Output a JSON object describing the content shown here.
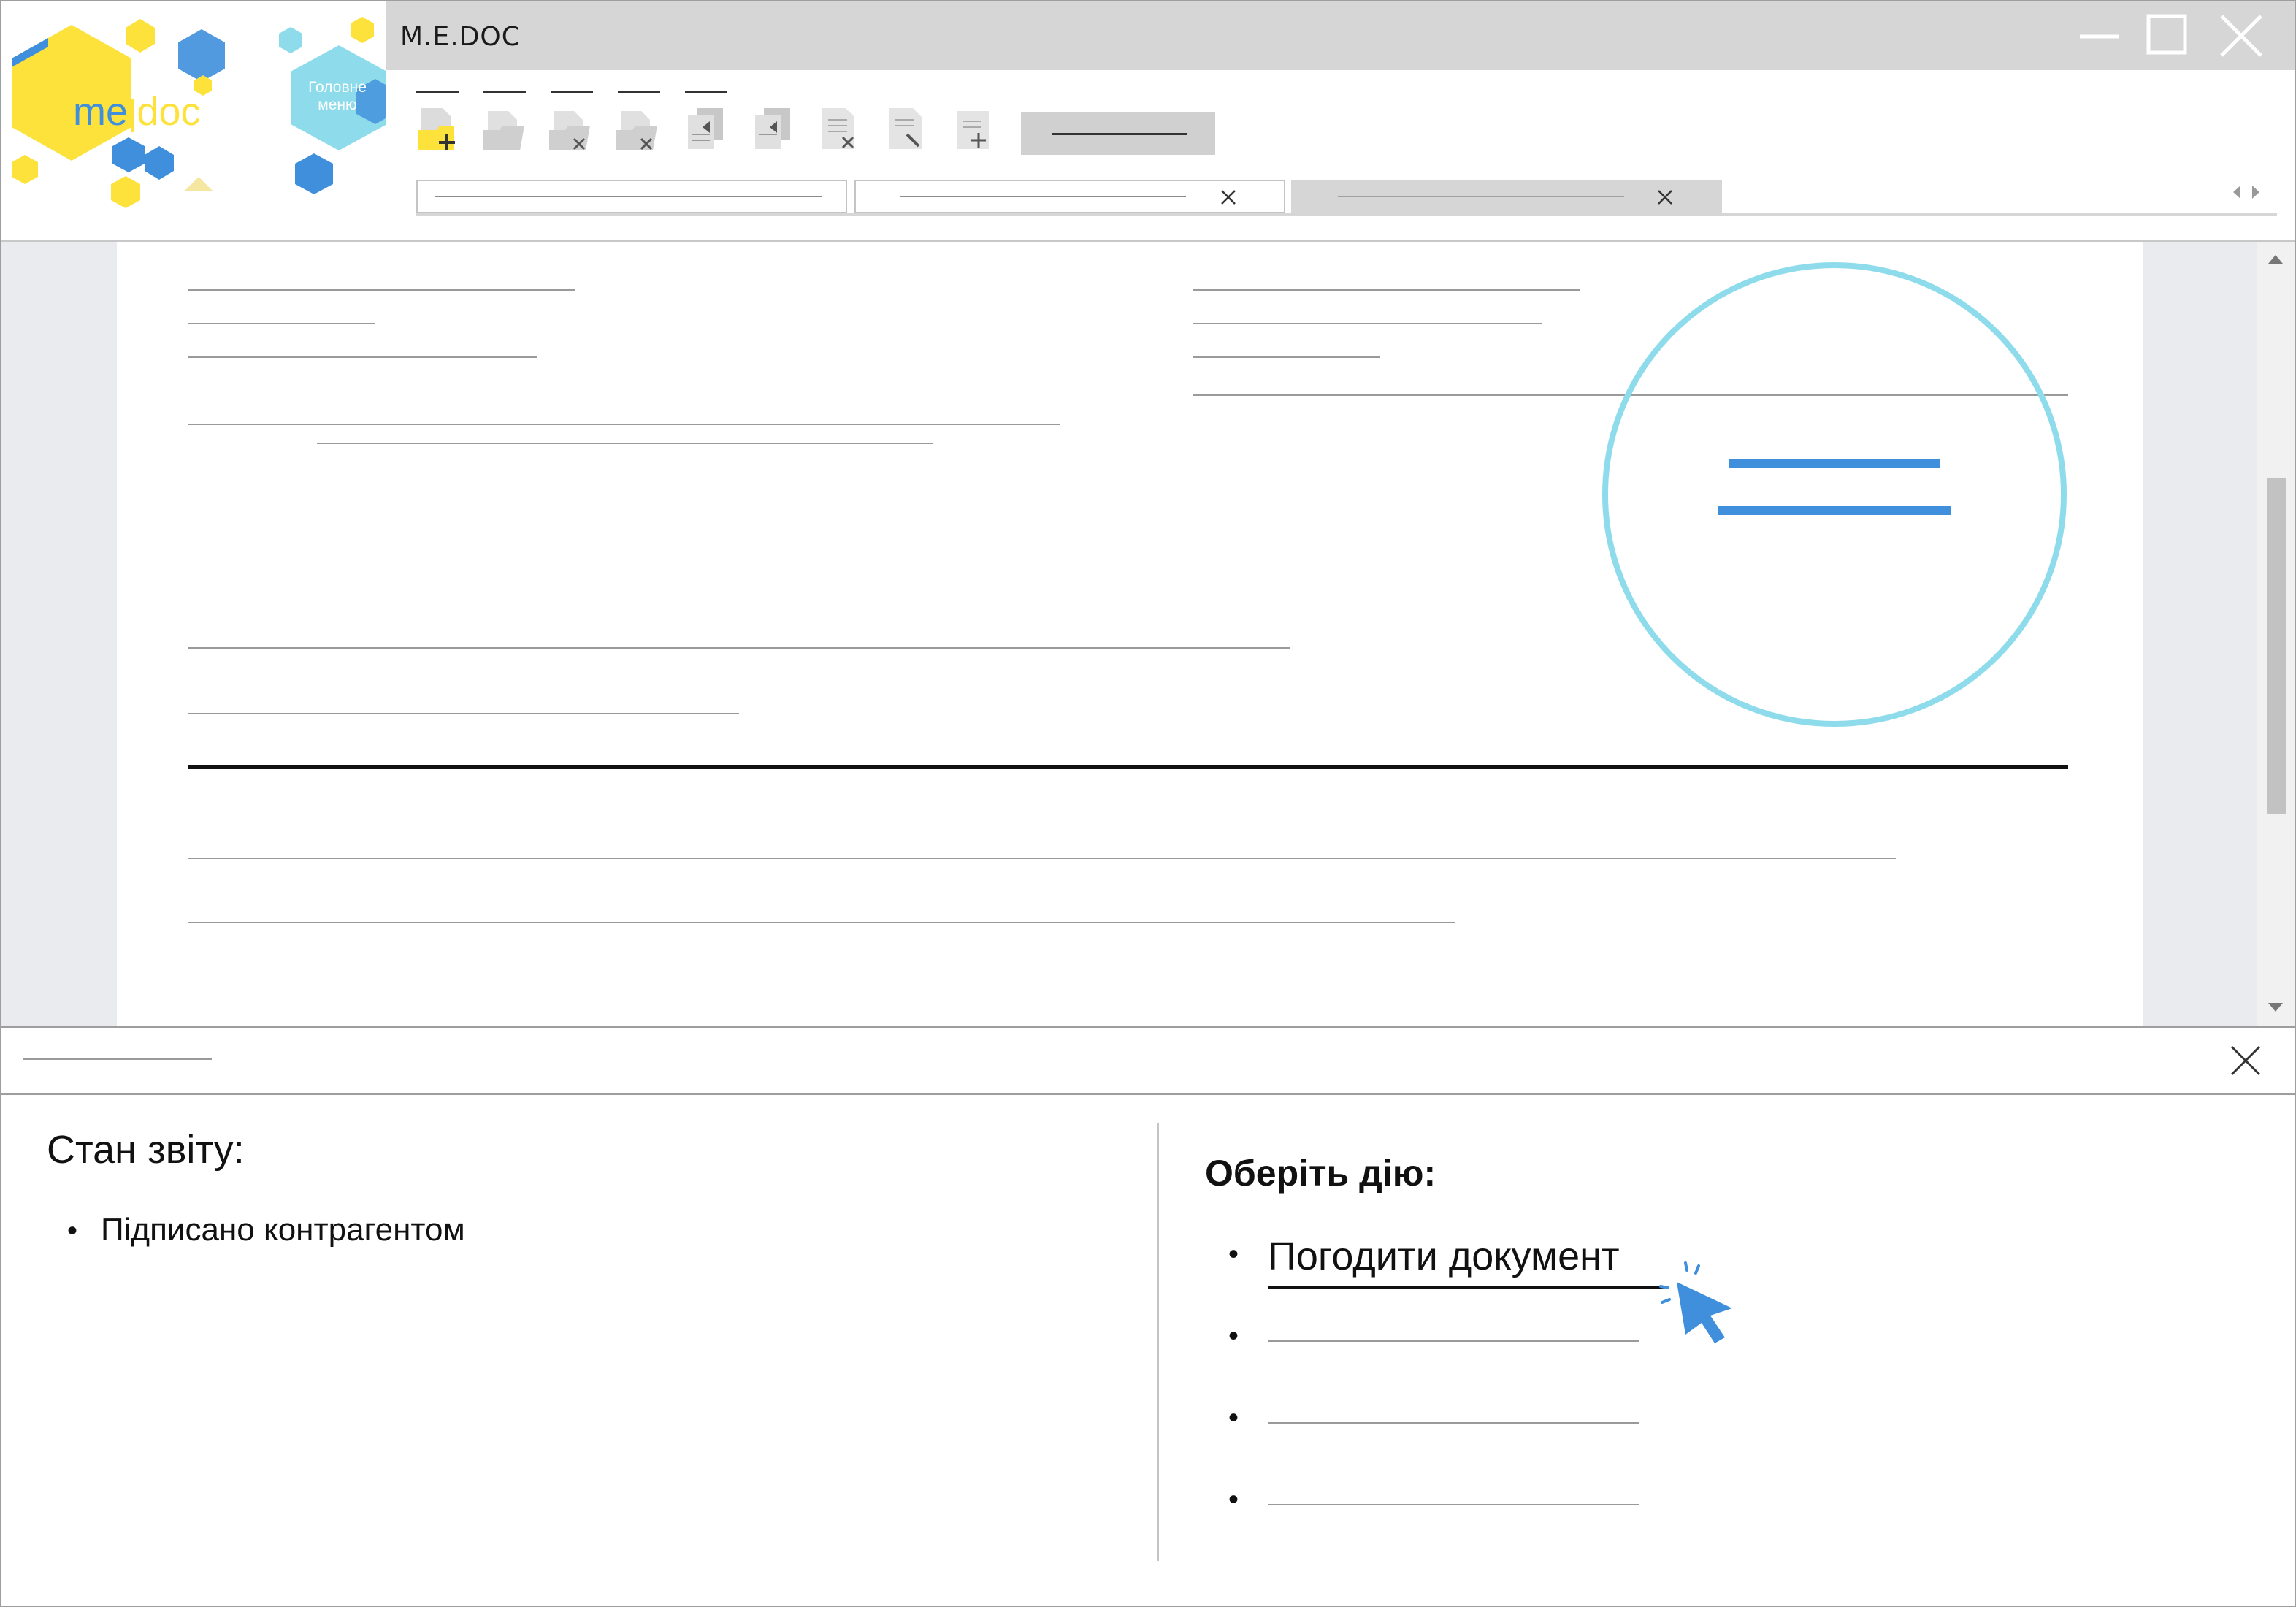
{
  "app": {
    "title": "M.E.DOC",
    "logo_text_me": "me",
    "logo_text_doc": "doc",
    "main_menu_label": "Головне меню"
  },
  "window_controls": {
    "minimize_icon": "minimize-icon",
    "maximize_icon": "maximize-icon",
    "close_icon": "close-icon"
  },
  "toolbar": {
    "icons": [
      "new-document-icon",
      "open-folder-icon",
      "delete-document-icon",
      "delete-folder-icon",
      "copy-document-icon",
      "move-document-icon",
      "reject-document-icon",
      "edit-document-icon",
      "add-document-icon"
    ]
  },
  "tabs": [
    {
      "closable": false,
      "active": false
    },
    {
      "closable": true,
      "active": false
    },
    {
      "closable": true,
      "active": true
    }
  ],
  "bottom_panel": {
    "status_title": "Стан звіту:",
    "status_items": [
      "Підписано контрагентом"
    ],
    "action_title": "Оберіть дію:",
    "actions": [
      "Погодити документ"
    ]
  },
  "colors": {
    "accent_yellow": "#fde23c",
    "accent_blue": "#3f8fdc",
    "accent_cyan": "#8edceb",
    "titlebar_gray": "#d6d6d6"
  }
}
